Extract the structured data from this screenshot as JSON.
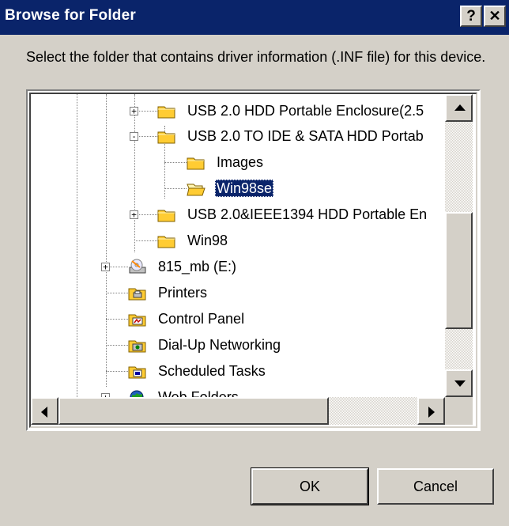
{
  "window": {
    "title": "Browse for Folder",
    "help_button": "?",
    "close_button": "✕"
  },
  "instruction": "Select the folder that contains driver information (.INF file) for this device.",
  "tree": {
    "nodes": [
      {
        "label": "USB 2.0 HDD Portable Enclosure(2.5",
        "icon": "folder-icon",
        "expander": "+"
      },
      {
        "label": "USB 2.0 TO IDE & SATA HDD Portab",
        "icon": "folder-icon",
        "expander": "-"
      },
      {
        "label": "Images",
        "icon": "folder-icon",
        "expander": ""
      },
      {
        "label": "Win98se",
        "icon": "open-folder-icon",
        "expander": "",
        "selected": true
      },
      {
        "label": "USB 2.0&IEEE1394 HDD Portable En",
        "icon": "folder-icon",
        "expander": "+"
      },
      {
        "label": "Win98",
        "icon": "folder-icon",
        "expander": ""
      },
      {
        "label": "815_mb (E:)",
        "icon": "cd-drive-icon",
        "expander": "+"
      },
      {
        "label": "Printers",
        "icon": "printers-folder-icon",
        "expander": ""
      },
      {
        "label": "Control Panel",
        "icon": "control-panel-icon",
        "expander": ""
      },
      {
        "label": "Dial-Up Networking",
        "icon": "dialup-networking-icon",
        "expander": ""
      },
      {
        "label": "Scheduled Tasks",
        "icon": "scheduled-tasks-icon",
        "expander": ""
      },
      {
        "label": "Web Folders",
        "icon": "web-folders-icon",
        "expander": "+"
      }
    ]
  },
  "buttons": {
    "ok": "OK",
    "cancel": "Cancel"
  },
  "colors": {
    "titlebar": "#0a246a",
    "face": "#d4d0c8",
    "folder": "#ffcc33",
    "selection": "#0a246a"
  }
}
